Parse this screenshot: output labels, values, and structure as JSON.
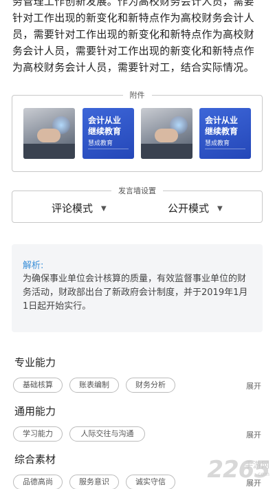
{
  "article": {
    "text": "务管理工作创新发展。作为高校财务会计人员，需要针对工作出现的新变化和新特点作为高校财务会计人员，需要针对工作出现的新变化和新特点作为高校财务会计人员，需要针对工作出现的新变化和新特点作为高校财务会计人员，需要针对工，结合实际情况。"
  },
  "attachments": {
    "title": "附件",
    "card_title": "会计从业\n继续教育",
    "card_sub": "慧成教育"
  },
  "settings": {
    "title": "发言墙设置",
    "comment_mode": "评论模式",
    "public_mode": "公开模式",
    "arrow": "▼"
  },
  "analysis": {
    "label": "解析:",
    "text": "为确保事业单位会计核算的质量，有效监督事业单位的财务活动，财政部出台了新政府会计制度，并于2019年1月1日起开始实行。"
  },
  "sections": [
    {
      "title": "专业能力",
      "tags": [
        "基础核算",
        "账表编制",
        "财务分析"
      ],
      "expand": "展开"
    },
    {
      "title": "通用能力",
      "tags": [
        "学习能力",
        "人际交往与沟通"
      ],
      "expand": "展开"
    },
    {
      "title": "综合素材",
      "tags": [
        "品德高尚",
        "服务意识",
        "诚实守信"
      ],
      "expand": "展开"
    }
  ],
  "watermark": {
    "num": "2265",
    "site": "手游网",
    "url": ".com"
  },
  "colors": {
    "accent": "#3a8fd8",
    "card": "#2d55c8"
  }
}
